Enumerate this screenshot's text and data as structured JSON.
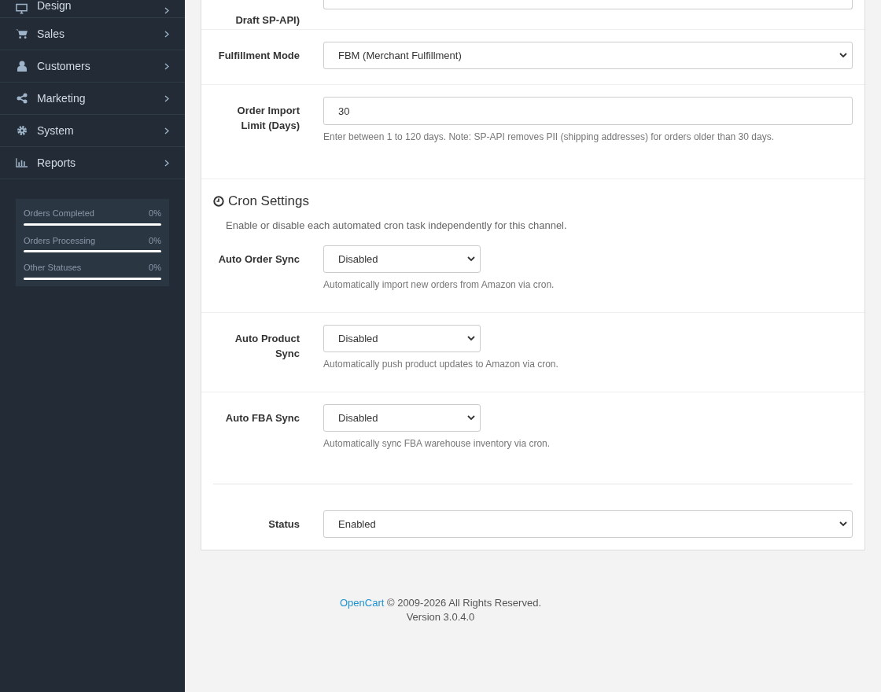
{
  "sidebar": {
    "menu": [
      {
        "label": "Design"
      },
      {
        "label": "Sales"
      },
      {
        "label": "Customers"
      },
      {
        "label": "Marketing"
      },
      {
        "label": "System"
      },
      {
        "label": "Reports"
      }
    ],
    "stats": [
      {
        "label": "Orders Completed",
        "reading": "0%",
        "level": 0
      },
      {
        "label": "Orders Processing",
        "reading": "0%",
        "level": 0
      },
      {
        "label": "Other Statuses",
        "reading": "0%",
        "level": 0
      }
    ]
  },
  "form": {
    "top_row": {
      "label": "Draft SP-API)"
    },
    "fields": [
      {
        "kind": "select",
        "label": "Fulfillment Mode",
        "value": "FBM (Merchant Fulfillment)"
      },
      {
        "kind": "input",
        "label": "Order Import Limit (Days)",
        "value": "30",
        "help": "Enter between 1 to 120 days. Note: SP-API removes PII (shipping addresses) for orders older than 30 days."
      }
    ],
    "cron": {
      "title": "Cron Settings",
      "description": "Enable or disable each automated cron task independently for this channel.",
      "fields": [
        {
          "label": "Auto Order Sync",
          "value": "Disabled",
          "help": "Automatically import new orders from Amazon via cron."
        },
        {
          "label": "Auto Product Sync",
          "value": "Disabled",
          "help": "Automatically push product updates to Amazon via cron."
        },
        {
          "label": "Auto FBA Sync",
          "value": "Disabled",
          "help": "Automatically sync FBA warehouse inventory via cron."
        }
      ]
    },
    "status": {
      "label": "Status",
      "value": "Enabled"
    }
  },
  "footer": {
    "link": "OpenCart",
    "text": "© 2009-2026 All Rights Reserved.",
    "version": "Version 3.0.4.0"
  }
}
